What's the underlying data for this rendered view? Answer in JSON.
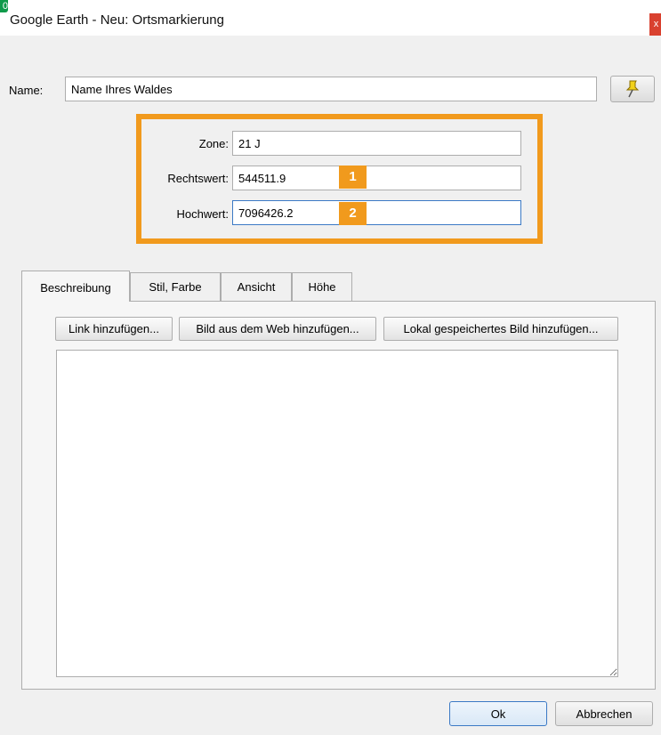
{
  "window": {
    "title": "Google Earth - Neu: Ortsmarkierung",
    "close_glyph": "x",
    "corner_glyph": "0"
  },
  "name_field": {
    "label": "Name:",
    "value": "Name Ihres Waldes"
  },
  "pin_button": {
    "icon": "pushpin-icon",
    "color": "#f2d21b"
  },
  "coordinates": {
    "highlight_color": "#f19a1d",
    "zone": {
      "label": "Zone:",
      "value": "21 J"
    },
    "easting": {
      "label": "Rechtswert:",
      "value": "544511.9",
      "marker": "1"
    },
    "northing": {
      "label": "Hochwert:",
      "value": "7096426.2",
      "marker": "2"
    }
  },
  "tabs": [
    {
      "label": "Beschreibung",
      "active": true
    },
    {
      "label": "Stil, Farbe",
      "active": false
    },
    {
      "label": "Ansicht",
      "active": false
    },
    {
      "label": "Höhe",
      "active": false
    }
  ],
  "description_toolbar": {
    "add_link": "Link hinzufügen...",
    "add_web_image": "Bild aus dem Web hinzufügen...",
    "add_local_image": "Lokal gespeichertes Bild hinzufügen..."
  },
  "description_text": "",
  "footer": {
    "ok_label": "Ok",
    "cancel_label": "Abbrechen"
  }
}
